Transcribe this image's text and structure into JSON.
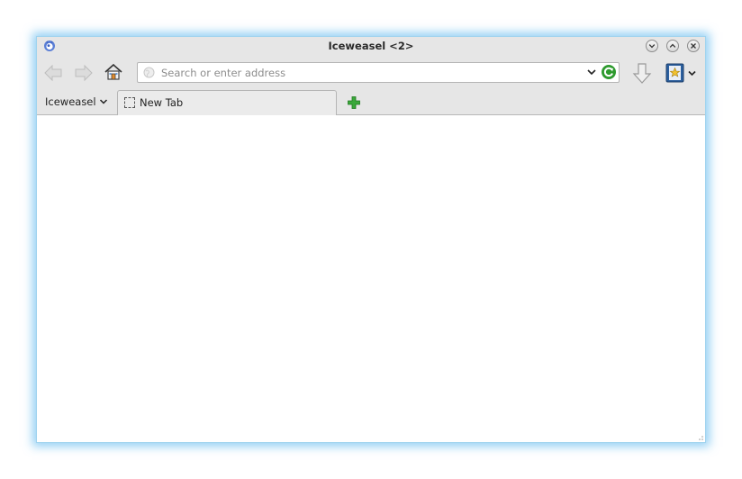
{
  "window": {
    "title": "Iceweasel <2>",
    "app_icon": "iceweasel-logo-icon",
    "controls": [
      "minimize-icon",
      "maximize-icon",
      "close-icon"
    ]
  },
  "navbar": {
    "back_icon": "back-arrow-icon",
    "forward_icon": "forward-arrow-icon",
    "home_icon": "home-icon",
    "url": {
      "value": "",
      "placeholder": "Search or enter address",
      "site_icon": "globe-icon",
      "dropdown_icon": "chevron-down-icon",
      "reload_icon": "reload-icon"
    },
    "download_icon": "download-arrow-icon",
    "bookmarks_icon": "bookmarks-star-icon"
  },
  "tabbar": {
    "menu_label": "Iceweasel",
    "tabs": [
      {
        "label": "New Tab",
        "active": true
      }
    ],
    "newtab_icon": "plus-icon"
  },
  "colors": {
    "window_bg": "#e6e6e6",
    "focus_glow": "#40aaeb",
    "reload_green": "#2e9a2e",
    "newtab_green": "#3aa83a",
    "bookmarks_blue": "#2b5f9e"
  }
}
